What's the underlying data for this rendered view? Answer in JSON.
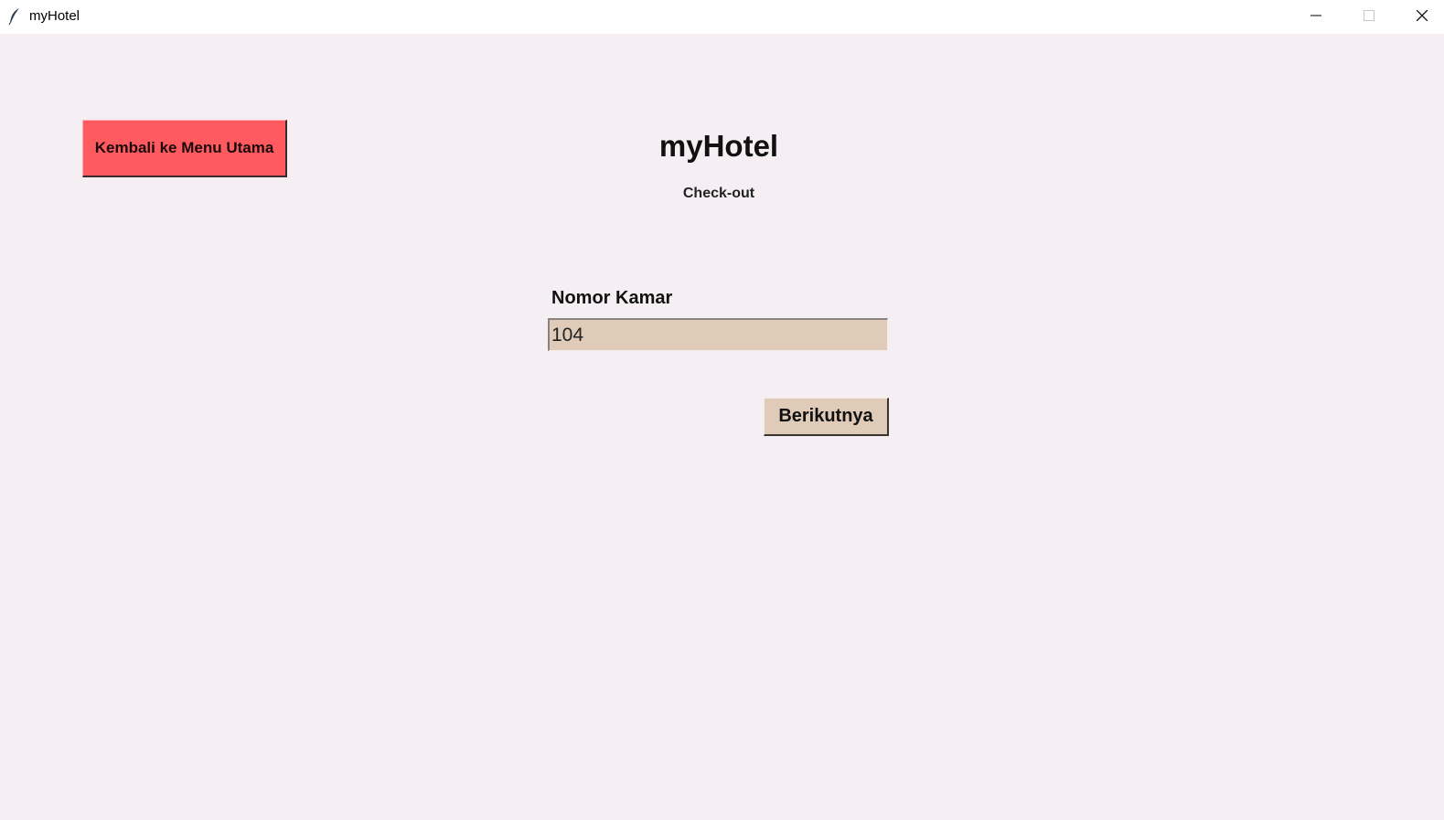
{
  "window": {
    "title": "myHotel",
    "icon": "feather-icon",
    "controls": {
      "minimize_icon": "minimize-icon",
      "maximize_icon": "maximize-icon",
      "close_icon": "close-icon"
    }
  },
  "header": {
    "back_button_label": "Kembali ke Menu Utama",
    "app_title": "myHotel",
    "page_subtitle": "Check-out"
  },
  "form": {
    "room_number_label": "Nomor Kamar",
    "room_number_value": "104",
    "next_button_label": "Berikutnya"
  },
  "colors": {
    "background": "#f5eff4",
    "back_button": "#ff5a5f",
    "input_and_next_button": "#dfcbb8",
    "titlebar": "#ffffff"
  }
}
